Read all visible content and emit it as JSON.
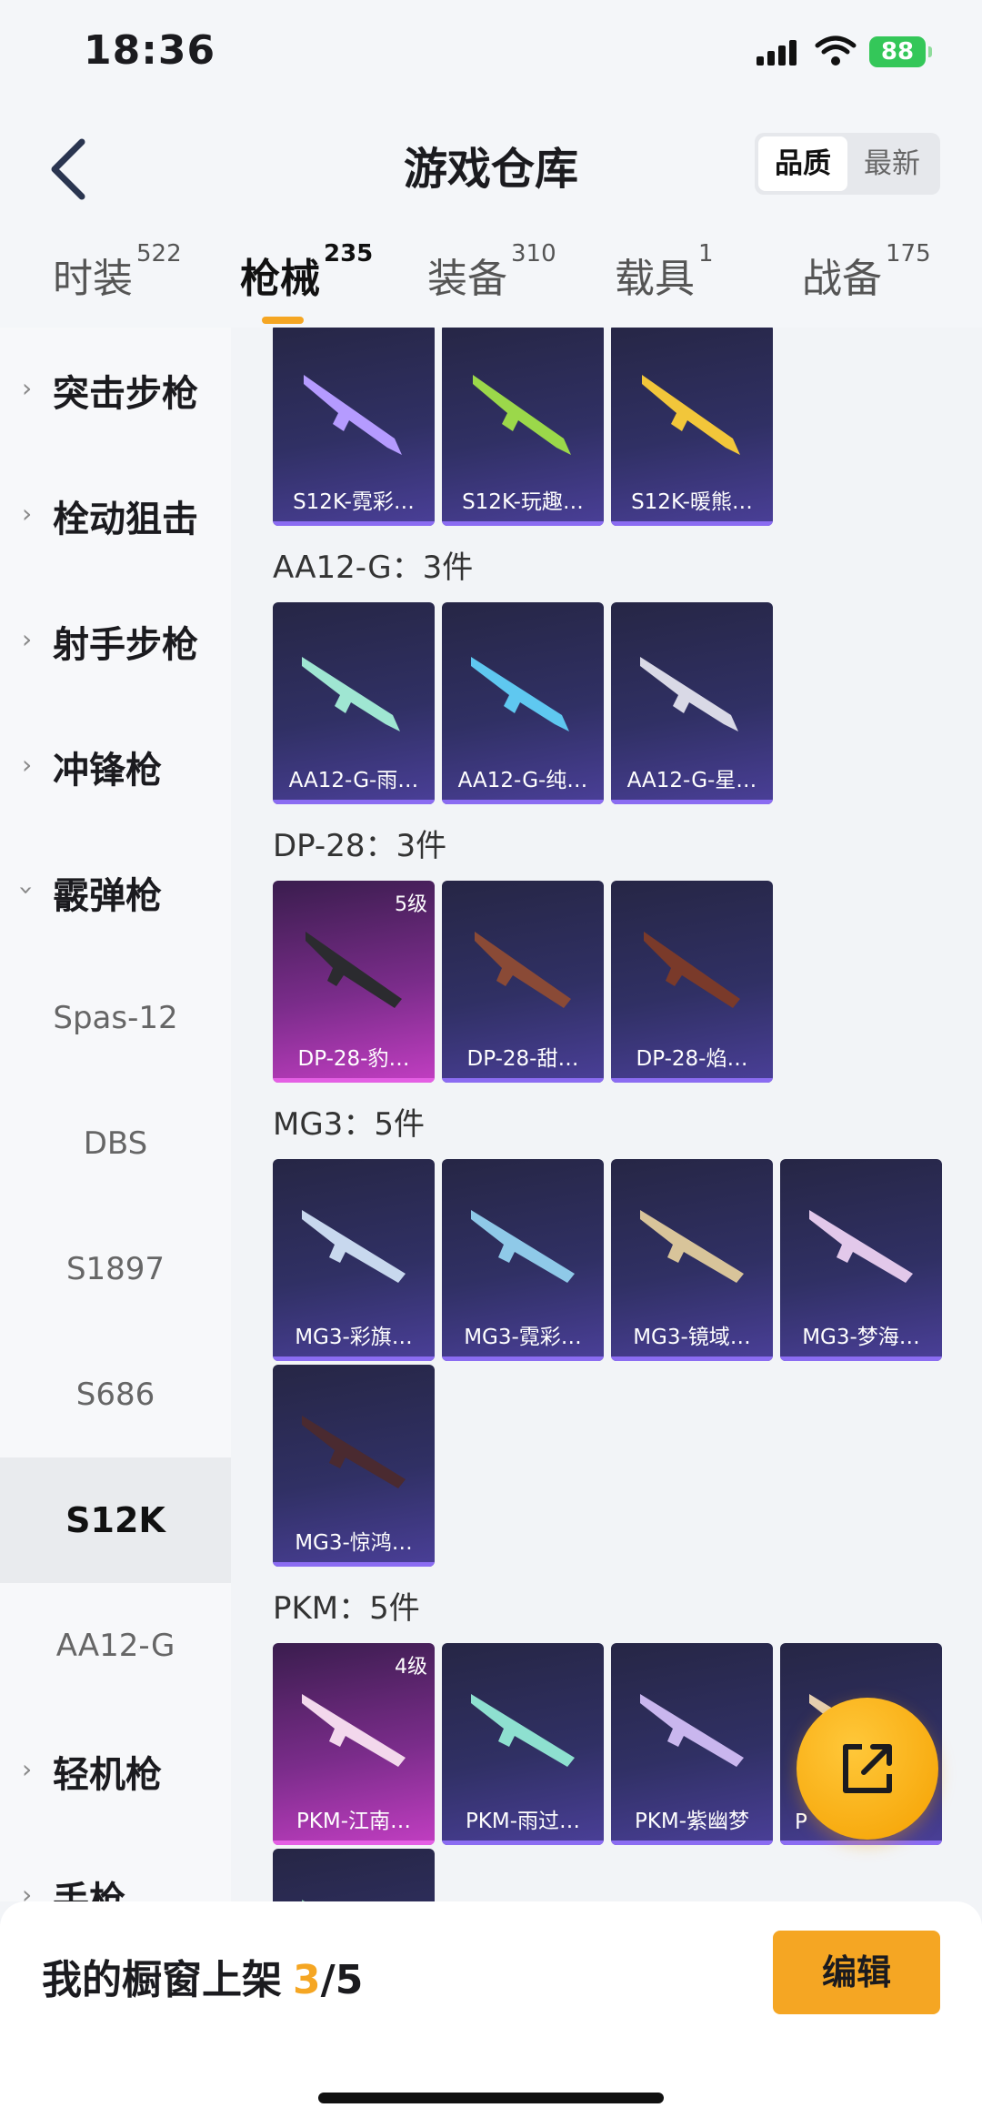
{
  "status": {
    "time": "18:36",
    "battery": "88"
  },
  "nav": {
    "title": "游戏仓库",
    "sort": [
      "品质",
      "最新"
    ]
  },
  "tabs": [
    {
      "label": "时装",
      "count": "522"
    },
    {
      "label": "枪械",
      "count": "235"
    },
    {
      "label": "装备",
      "count": "310"
    },
    {
      "label": "载具",
      "count": "1"
    },
    {
      "label": "战备",
      "count": "175"
    }
  ],
  "sidebar": {
    "categories": [
      "突击步枪",
      "栓动狙击",
      "射手步枪",
      "冲锋枪",
      "霰弹枪",
      "轻机枪",
      "手枪"
    ],
    "subitems": [
      "Spas-12",
      "DBS",
      "S1897",
      "S686",
      "S12K",
      "AA12-G"
    ]
  },
  "groups": [
    {
      "title": "AA12-G：3件"
    },
    {
      "title": "DP-28：3件"
    },
    {
      "title": "MG3：5件"
    },
    {
      "title": "PKM：5件"
    }
  ],
  "items": {
    "s12k": [
      "S12K-霓彩…",
      "S12K-玩趣…",
      "S12K-暖熊…"
    ],
    "aa12": [
      "AA12-G-雨…",
      "AA12-G-纯…",
      "AA12-G-星…"
    ],
    "dp28": [
      "DP-28-豹…",
      "DP-28-甜…",
      "DP-28-焰…"
    ],
    "mg3": [
      "MG3-彩旗…",
      "MG3-霓彩…",
      "MG3-镜域…",
      "MG3-梦海…",
      "MG3-惊鸿…"
    ],
    "pkm": [
      "PKM-江南…",
      "PKM-雨过…",
      "PKM-紫幽梦",
      "P"
    ]
  },
  "levels": {
    "dp28_first": "5级",
    "pkm_first": "4级"
  },
  "bottom": {
    "shelf_label": "我的橱窗上架",
    "shelf_current": "3",
    "shelf_total": "/5",
    "edit_label": "编辑"
  },
  "colors": {
    "accent": "#f5a623",
    "card_bg": "#303064",
    "card_gold": "#7a2c8a"
  }
}
